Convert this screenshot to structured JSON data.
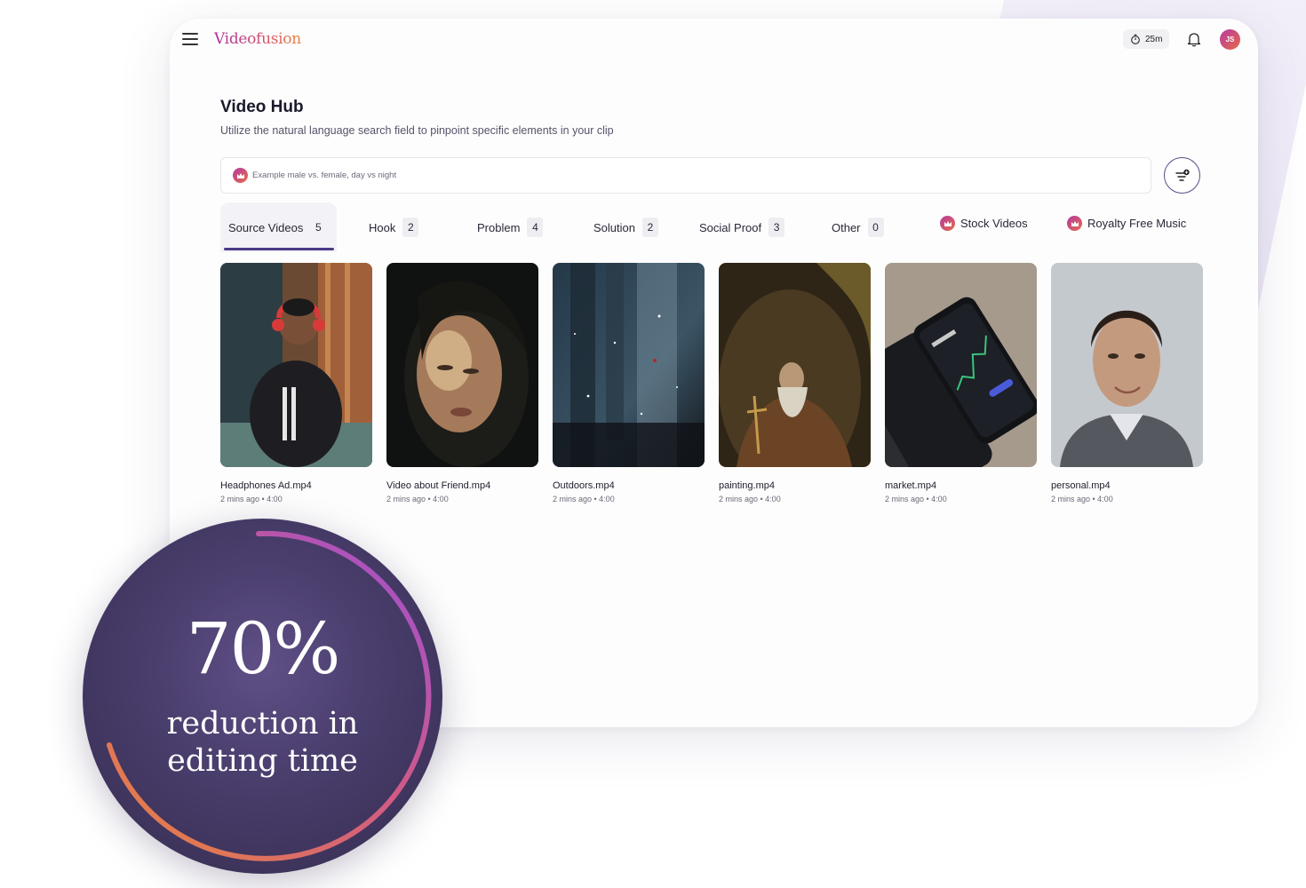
{
  "app": {
    "logo": "Videofusion",
    "timer": "25m",
    "avatar_initials": "JS"
  },
  "hub": {
    "title": "Video Hub",
    "subtitle": "Utilize the natural language search field to pinpoint specific elements in your clip",
    "search_placeholder": "Example male vs. female, day vs night"
  },
  "tabs": [
    {
      "label": "Source Videos",
      "count": "5",
      "active": true
    },
    {
      "label": "Hook",
      "count": "2"
    },
    {
      "label": "Problem",
      "count": "4"
    },
    {
      "label": "Solution",
      "count": "2"
    },
    {
      "label": "Social Proof",
      "count": "3"
    },
    {
      "label": "Other",
      "count": "0"
    }
  ],
  "premium_tabs": [
    {
      "label": "Stock Videos",
      "icon": "crown-icon"
    },
    {
      "label": "Royalty Free Music",
      "icon": "crown-icon"
    }
  ],
  "videos": [
    {
      "name": "Headphones Ad.mp4",
      "meta": "2 mins ago • 4:00"
    },
    {
      "name": "Video about Friend.mp4",
      "meta": "2 mins ago • 4:00"
    },
    {
      "name": "Outdoors.mp4",
      "meta": "2 mins ago • 4:00"
    },
    {
      "name": "painting.mp4",
      "meta": "2 mins ago • 4:00"
    },
    {
      "name": "market.mp4",
      "meta": "2 mins ago • 4:00"
    },
    {
      "name": "personal.mp4",
      "meta": "2 mins ago • 4:00"
    }
  ],
  "stat": {
    "value": "70%",
    "label": "reduction in editing time"
  },
  "colors": {
    "accent": "#4b3a86",
    "brand_gradient_start": "#a92f9c",
    "brand_gradient_end": "#e8843f",
    "badge_bg": "#4a3e6d"
  }
}
